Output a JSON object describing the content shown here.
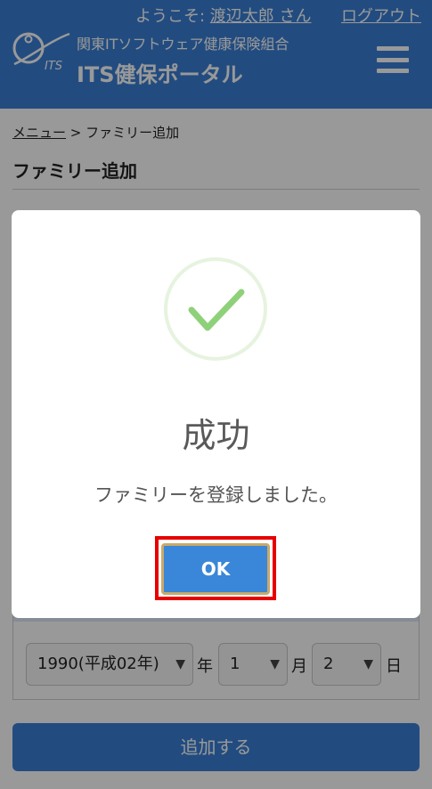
{
  "header": {
    "welcome_prefix": "ようこそ:",
    "user_name": "渡辺太郎 さん",
    "logout_label": "ログアウト",
    "logo_text": "ITS",
    "org_name": "関東ITソフトウェア健康保険組合",
    "portal_name": "ITS健保ポータル",
    "menu_icon": "hamburger-menu-icon"
  },
  "breadcrumb": {
    "menu_link": "メニュー",
    "separator": ">",
    "current": "ファミリー追加"
  },
  "page": {
    "title": "ファミリー追加"
  },
  "birthdate": {
    "year_value": "1990(平成02年)",
    "year_unit": "年",
    "month_value": "1",
    "month_unit": "月",
    "day_value": "2",
    "day_unit": "日"
  },
  "submit_label": "追加する",
  "modal": {
    "icon": "success-check-icon",
    "title": "成功",
    "message": "ファミリーを登録しました。",
    "ok_label": "OK"
  },
  "colors": {
    "header_blue": "#3a7fd6",
    "success_green": "#8fd17a",
    "highlight_red": "#e80000"
  }
}
